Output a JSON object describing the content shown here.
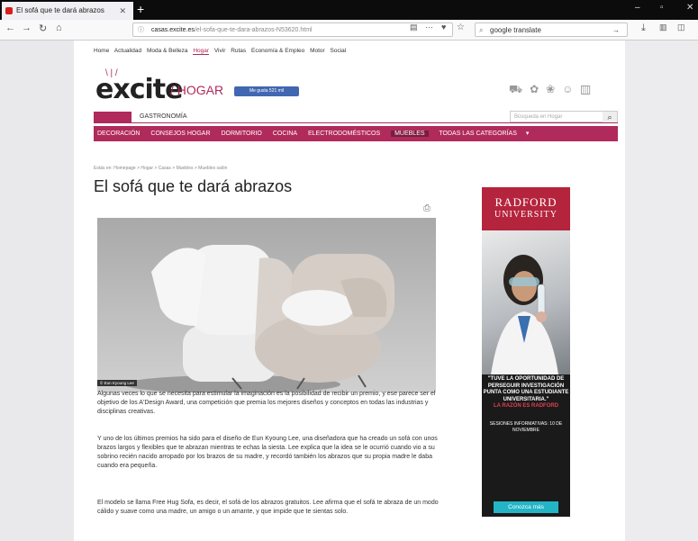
{
  "browser": {
    "tab_title": "El sofá que te dará abrazos",
    "url_domain": "casas.excite.es",
    "url_path": "/el-sofa-que-te-dara-abrazos-N53620.html",
    "search_value": "google translate"
  },
  "site": {
    "top_nav": [
      "Home",
      "Actualidad",
      "Moda & Belleza",
      "Hogar",
      "Vivir",
      "Rutas",
      "Economía & Empleo",
      "Motor",
      "Social"
    ],
    "top_nav_active_index": 3,
    "logo_text": "excite",
    "section": "/ HOGAR",
    "like_button": "Me gusta 521 mil",
    "subnav_item": "GASTRONOMÍA",
    "search_placeholder": "Búsqueda en Hogar",
    "categories": [
      "DECORACIÓN",
      "CONSEJOS HOGAR",
      "DORMITORIO",
      "COCINA",
      "ELECTRODOMÉSTICOS",
      "MUEBLES",
      "TODAS LAS CATEGORÍAS"
    ],
    "category_active_index": 5
  },
  "article": {
    "breadcrumb": "Estás en: Homepage > Hogar > Casas > Muebles > Muebles salón",
    "title": "El sofá que te dará abrazos",
    "photo_credit": "© Eun Kyoung Lee",
    "paragraphs": [
      "Algunas veces lo que se necesita para estimular la imaginación es la posibilidad de recibir un premio, y ese parece ser el objetivo de los A'Design Award, una competición que premia los mejores diseños y conceptos en todas las industrias y disciplinas creativas.",
      "Y uno de los últimos premios ha sido para el diseño de Eun Kyoung Lee, una diseñadora que ha creado un sofá con unos brazos largos y flexibles que te abrazan mientras te echas la siesta. Lee explica que la idea se le ocurrió cuando vio a su sobrino recién nacido arropado por los brazos de su madre, y recordó también los abrazos que su propia madre le daba cuando era pequeña.",
      "El modelo se llama Free Hug Sofa, es decir, el sofá de los abrazos gratuitos. Lee afirma que el sofá te abraza de un modo cálido y suave como una madre, un amigo o un amante, y que impide que te sientas solo."
    ]
  },
  "ad": {
    "brand_line1": "RADFORD",
    "brand_line2": "UNIVERSITY",
    "quote": "\"TUVE LA OPORTUNIDAD DE PERSEGUIR INVESTIGACIÓN PUNTA COMO UNA ESTUDIANTE UNIVERSITARIA.\"",
    "attribution": "LA RAZÓN ES RADFORD",
    "sessions": "SESIONES INFORMATIVAS: 10 DE NOVIEMBRE",
    "cta": "Conozca más"
  },
  "colors": {
    "brand": "#b02a5b",
    "ad_red": "#b5243d",
    "ad_cta": "#23b5c6"
  }
}
